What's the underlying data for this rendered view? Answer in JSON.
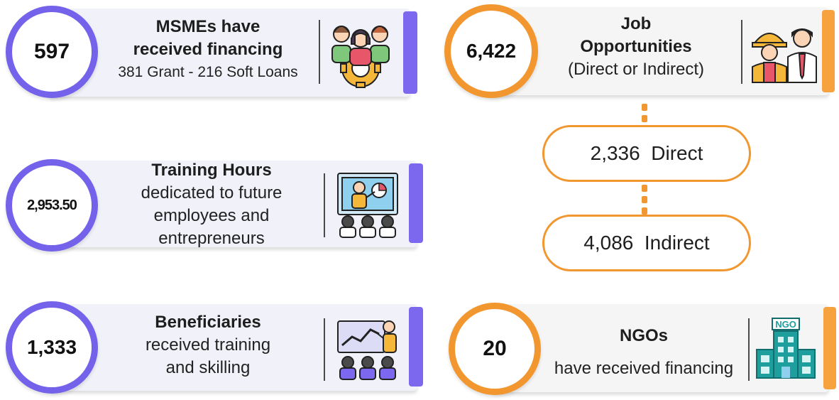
{
  "msmes": {
    "value": "597",
    "heading_1": "MSMEs have",
    "heading_2": "received financing",
    "sub": "381 Grant - 216 Soft Loans",
    "icon": "team-gear-icon"
  },
  "training": {
    "value": "2,953.50",
    "heading": "Training Hours",
    "line_1": "dedicated to future",
    "line_2": "employees and",
    "line_3": "entrepreneurs",
    "icon": "classroom-presentation-icon"
  },
  "beneficiaries": {
    "value": "1,333",
    "heading": "Beneficiaries",
    "line_1": "received training",
    "line_2": "and skilling",
    "icon": "chart-presentation-icon"
  },
  "jobs": {
    "value": "6,422",
    "heading_1": "Job",
    "heading_2": "Opportunities",
    "sub": "(Direct or Indirect)",
    "icon": "workers-icon",
    "direct": "2,336  Direct",
    "indirect": "4,086  Indirect"
  },
  "ngos": {
    "value": "20",
    "heading": "NGOs",
    "sub": "have received financing",
    "icon": "ngo-building-icon",
    "sign": "NGO"
  },
  "colors": {
    "purple": "#7462ea",
    "orange": "#f2962f"
  }
}
